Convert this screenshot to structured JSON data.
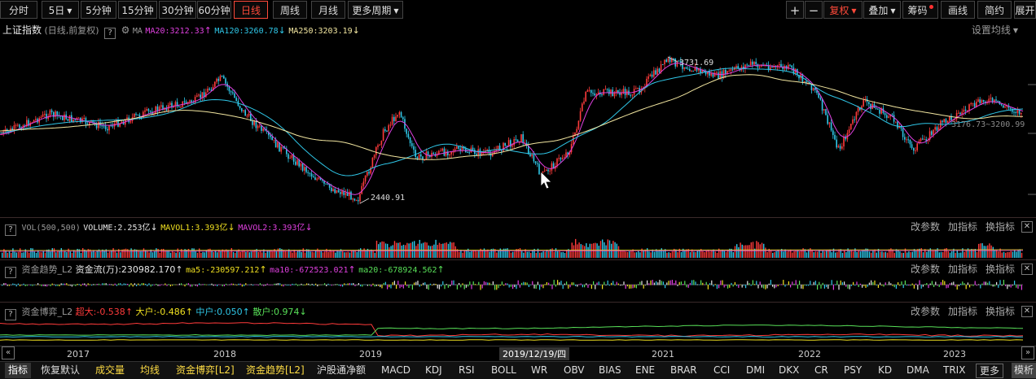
{
  "toolbar": {
    "periods": [
      "分时",
      "5日",
      "5分钟",
      "15分钟",
      "30分钟",
      "60分钟",
      "日线",
      "周线",
      "月线",
      "更多周期"
    ],
    "active_period": "日线",
    "right_buttons": [
      "+",
      "−",
      "复权",
      "叠加",
      "筹码",
      "画线",
      "简约",
      "展开"
    ]
  },
  "main": {
    "index_name": "上证指数",
    "index_sub": "(日线,前复权)",
    "ma_label": "MA",
    "ma20": "MA20:3212.33",
    "ma120": "MA120:3260.78",
    "ma250": "MA250:3203.19",
    "settings_link": "设置均线",
    "high_label": "3731.69",
    "low_label": "2440.91",
    "right_label": "3176.73~3200.99"
  },
  "vol_panel": {
    "name": "VOL(500,500)",
    "volume": "VOLUME:2.253亿",
    "mavol1": "MAVOL1:3.393亿",
    "mavol2": "MAVOL2:3.393亿",
    "links": [
      "改参数",
      "加指标",
      "换指标"
    ]
  },
  "flow_panel": {
    "name": "资金趋势_L2",
    "flow": "资金流(万):230982.170",
    "ma5": "ma5:-230597.212",
    "ma10": "ma10:-672523.021",
    "ma20": "ma20:-678924.562",
    "links": [
      "改参数",
      "加指标",
      "换指标"
    ]
  },
  "game_panel": {
    "name": "资金博弈_L2",
    "super": "超大:-0.538",
    "big": "大户:-0.486",
    "mid": "中户:0.050",
    "retail": "散户:0.974",
    "links": [
      "改参数",
      "加指标",
      "换指标"
    ]
  },
  "xaxis": {
    "years": [
      "2017",
      "2018",
      "2019",
      "2021",
      "2022",
      "2023"
    ],
    "cursor_date": "2019/12/19/四"
  },
  "bottom_tabs": [
    "指标",
    "恢复默认",
    "成交量",
    "均线",
    "资金博弈[L2]",
    "资金趋势[L2]",
    "沪股通净额",
    "MACD",
    "KDJ",
    "RSI",
    "BOLL",
    "WR",
    "OBV",
    "BIAS",
    "ENE",
    "BRAR",
    "CCI",
    "DMI",
    "DKX",
    "CR",
    "PSY",
    "KD",
    "DMA",
    "TRIX",
    "更多",
    "模析"
  ],
  "colors": {
    "up": "#ff3b3b",
    "down": "#2fc7e8",
    "ma20": "#e040e0",
    "ma120": "#2fc7e8",
    "ma250": "#f2e6a0",
    "active": "#ff4a3a"
  }
}
